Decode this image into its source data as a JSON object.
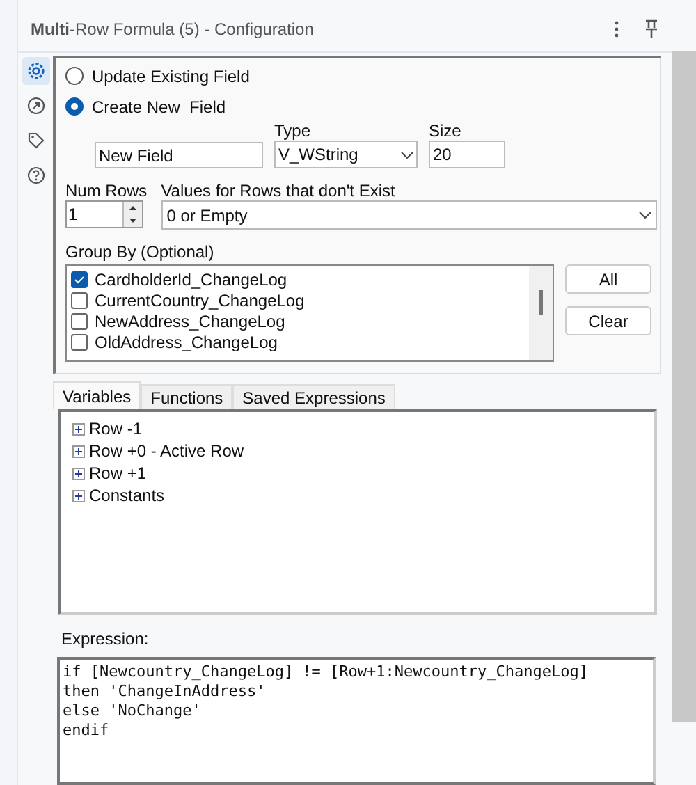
{
  "panel": {
    "title": "**Multi**-Row Formula (5) - Configuration"
  },
  "side_tabs": [
    {
      "kind": "gear",
      "selected": true
    },
    {
      "kind": "arrow",
      "selected": false
    },
    {
      "kind": "tag",
      "selected": false
    },
    {
      "kind": "help",
      "selected": false
    }
  ],
  "mode_options": [
    {
      "label": "Update Existing Field",
      "selected": false
    },
    {
      "label": "Create New  Field",
      "selected": true
    }
  ],
  "new_field": {
    "value": "New Field",
    "type_label": "Type",
    "type_value": "V_WString",
    "size_label": "Size",
    "size_value": "20"
  },
  "num_rows": {
    "label": "Num Rows",
    "value": "1"
  },
  "missing_rows": {
    "label": "Values for Rows that don't Exist",
    "value": "0 or Empty"
  },
  "group_by": {
    "label": "Group By (Optional)",
    "items": [
      {
        "label": "CardholderId_ChangeLog",
        "checked": true
      },
      {
        "label": "CurrentCountry_ChangeLog",
        "checked": false
      },
      {
        "label": "NewAddress_ChangeLog",
        "checked": false
      },
      {
        "label": "OldAddress_ChangeLog",
        "checked": false
      }
    ],
    "buttons": [
      "All",
      "Clear"
    ]
  },
  "tabs": [
    {
      "label": "Variables",
      "selected": true
    },
    {
      "label": "Functions",
      "selected": false
    },
    {
      "label": "Saved Expressions",
      "selected": false
    }
  ],
  "tree": [
    {
      "label": "Row -1",
      "expanded": false
    },
    {
      "label": "Row +0 - Active Row",
      "expanded": false
    },
    {
      "label": "Row +1",
      "expanded": false
    },
    {
      "label": "Constants",
      "expanded": false
    }
  ],
  "expression": {
    "label": "Expression:",
    "lines": [
      "if [Newcountry_ChangeLog] != [Row+1:Newcountry_ChangeLog]",
      "then 'ChangeInAddress'",
      "else 'NoChange'",
      "endif"
    ]
  }
}
